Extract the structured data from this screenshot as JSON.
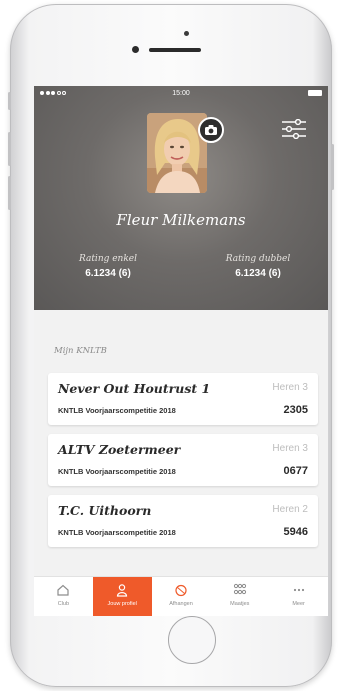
{
  "status_bar": {
    "time": "15:00"
  },
  "profile": {
    "name": "Fleur Milkemans",
    "rating_single_label": "Rating enkel",
    "rating_single_value": "6.1234 (6)",
    "rating_double_label": "Rating dubbel",
    "rating_double_value": "6.1234 (6)"
  },
  "section": {
    "title": "Mijn KNLTB"
  },
  "teams": [
    {
      "name": "Never Out Houtrust 1",
      "division": "Heren 3",
      "competition": "KNTLB Voorjaarscompetitie 2018",
      "number": "2305"
    },
    {
      "name": "ALTV Zoetermeer",
      "division": "Heren 3",
      "competition": "KNTLB Voorjaarscompetitie 2018",
      "number": "0677"
    },
    {
      "name": "T.C. Uithoorn",
      "division": "Heren 2",
      "competition": "KNTLB Voorjaarscompetitie 2018",
      "number": "5946"
    }
  ],
  "tabs": [
    {
      "label": "Club",
      "icon": "home-icon"
    },
    {
      "label": "Jouw profiel",
      "icon": "person-icon"
    },
    {
      "label": "Afhangen",
      "icon": "tennis-ball-icon"
    },
    {
      "label": "Maatjes",
      "icon": "group-icon"
    },
    {
      "label": "Meer",
      "icon": "more-icon"
    }
  ],
  "colors": {
    "accent": "#ef5a2a",
    "header_bg": "#6e6b69"
  }
}
